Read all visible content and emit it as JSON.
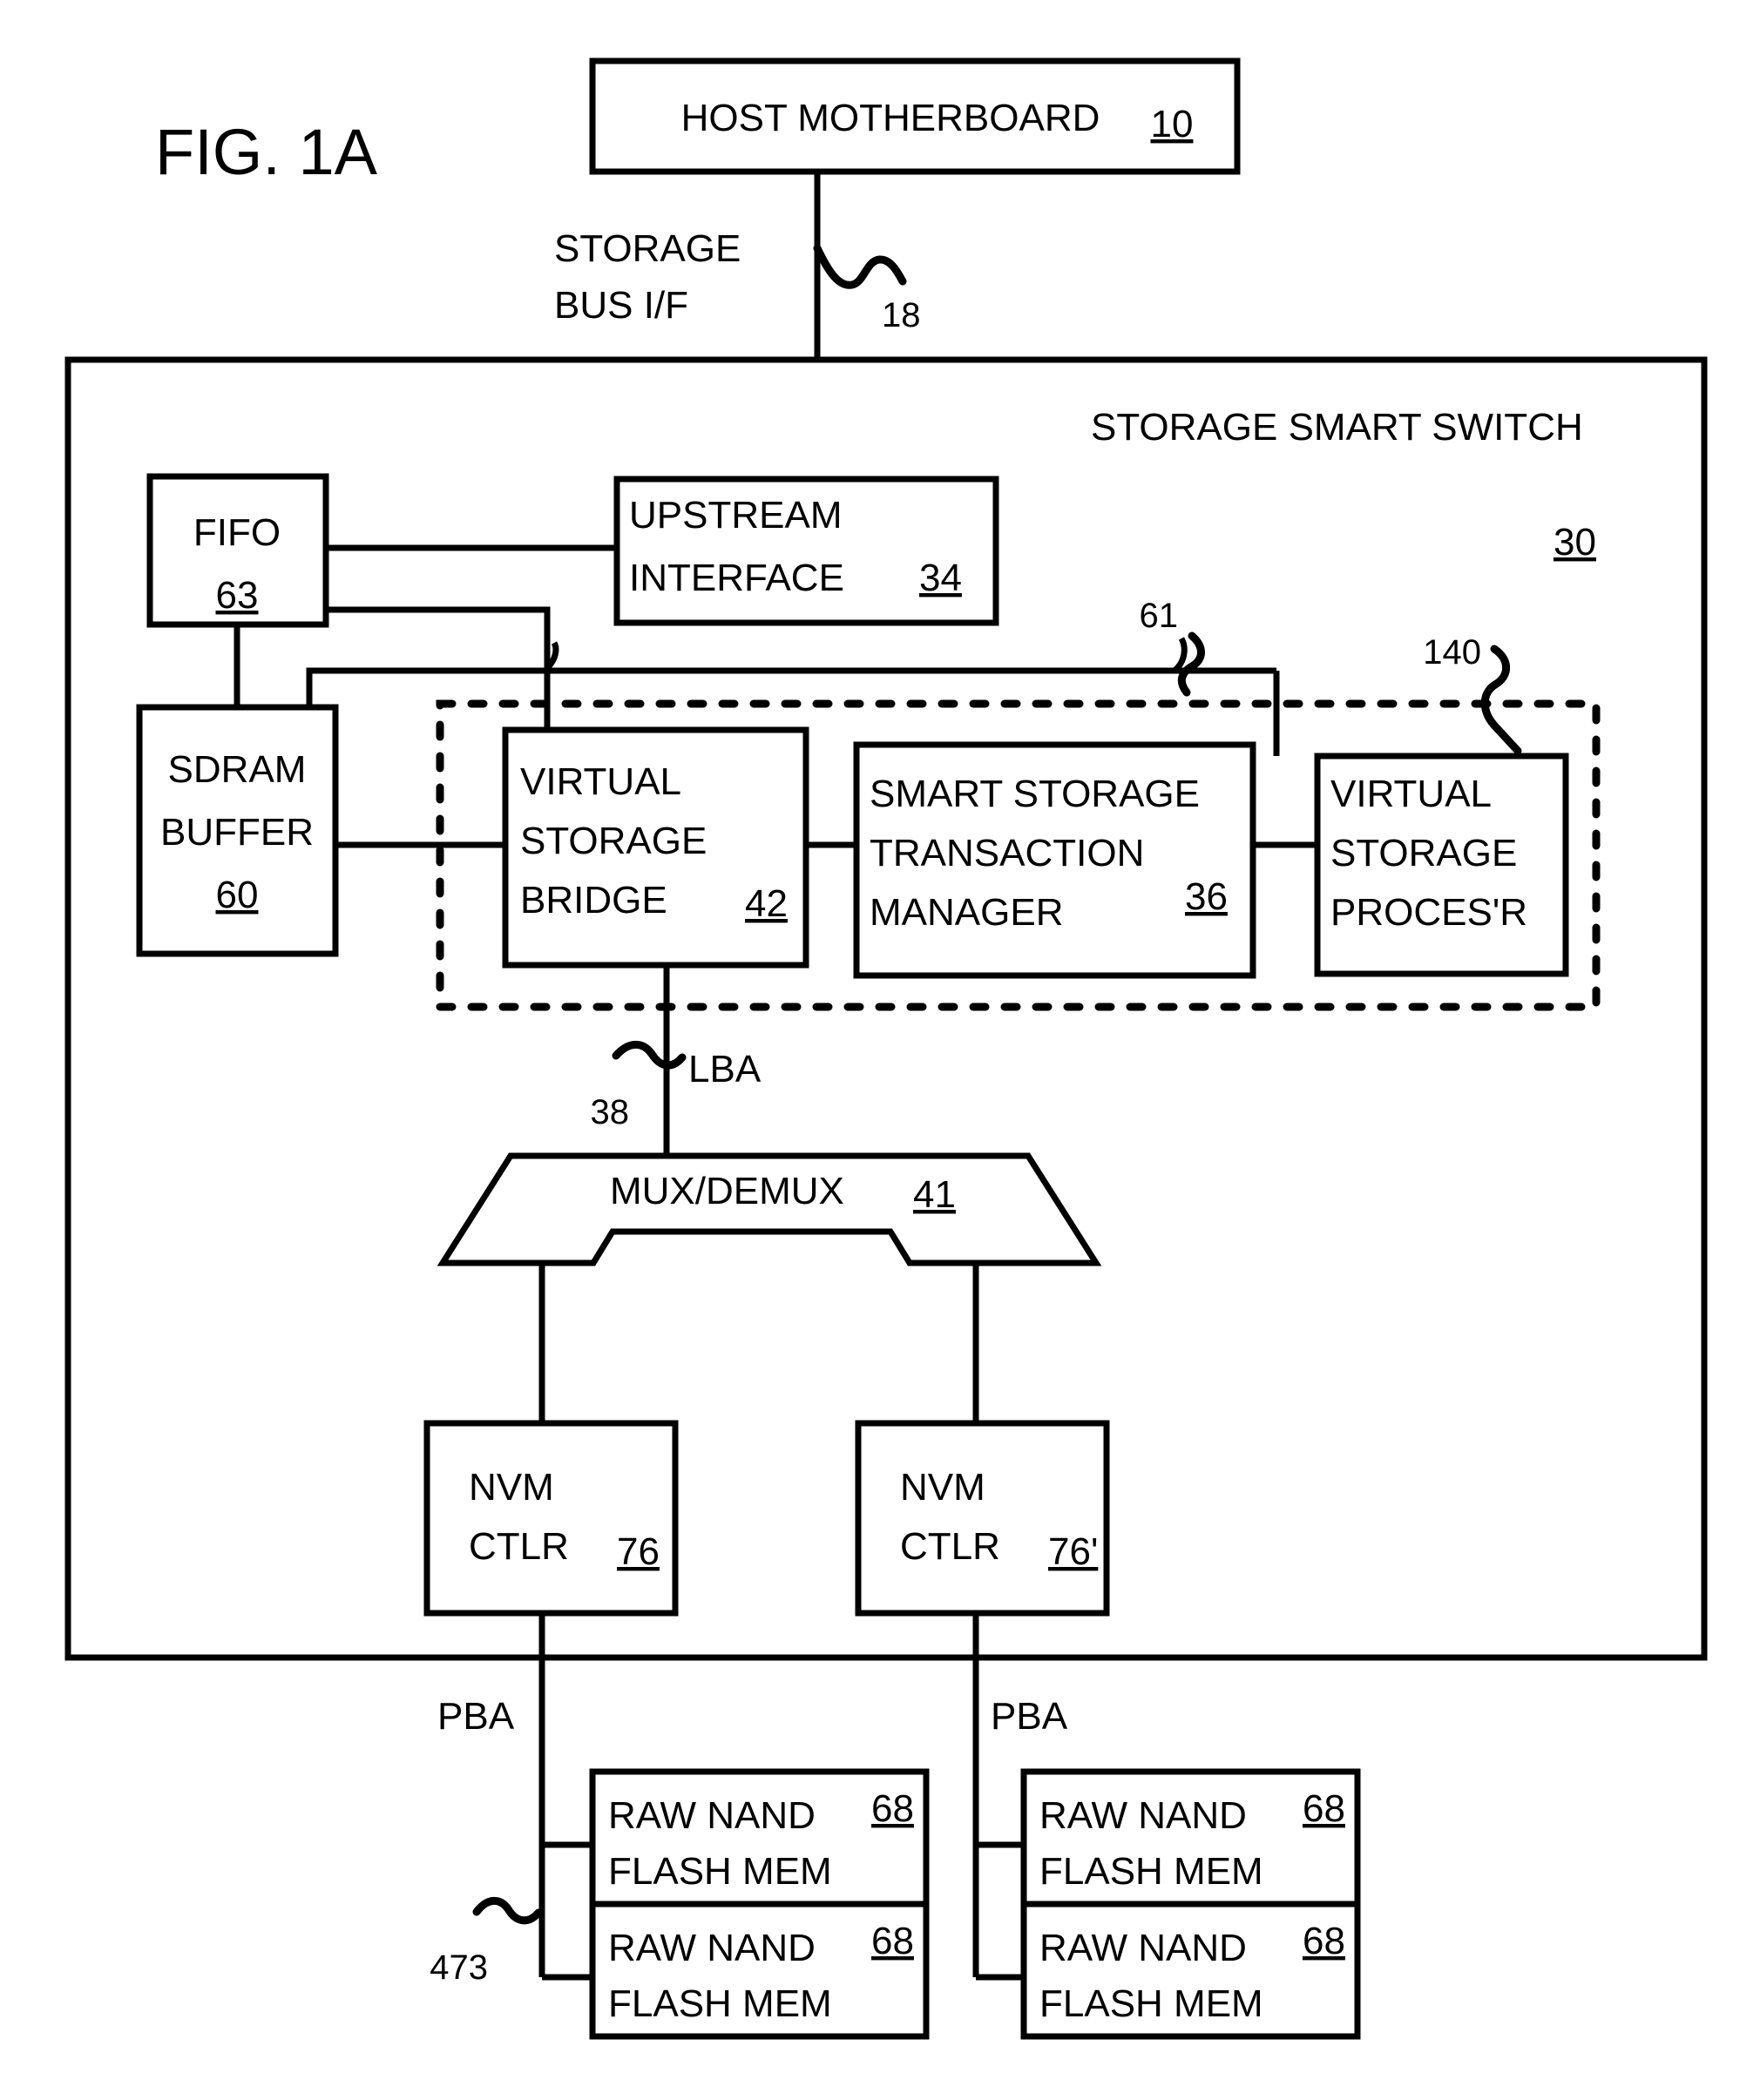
{
  "figure": {
    "label": "FIG. 1A"
  },
  "blocks": {
    "host_motherboard": {
      "title": "HOST MOTHERBOARD",
      "ref": "10"
    },
    "upstream_interface": {
      "line1": "UPSTREAM",
      "line2": "INTERFACE",
      "ref": "34"
    },
    "fifo": {
      "title": "FIFO",
      "ref": "63"
    },
    "sdram_buffer": {
      "line1": "SDRAM",
      "line2": "BUFFER",
      "ref": "60"
    },
    "virtual_storage_bridge": {
      "line1": "VIRTUAL",
      "line2": "STORAGE",
      "line3": "BRIDGE",
      "ref": "42"
    },
    "smart_storage_transaction_manager": {
      "line1": "SMART STORAGE",
      "line2": "TRANSACTION",
      "line3": "MANAGER",
      "ref": "36"
    },
    "virtual_storage_processor": {
      "line1": "VIRTUAL",
      "line2": "STORAGE",
      "line3": "PROCES'R"
    },
    "mux_demux": {
      "title": "MUX/DEMUX",
      "ref": "41"
    },
    "nvm_ctlr_left": {
      "line1": "NVM",
      "line2": "CTLR",
      "ref": "76"
    },
    "nvm_ctlr_right": {
      "line1": "NVM",
      "line2": "CTLR",
      "ref": "76'"
    },
    "raw_nand_l1": {
      "line1": "RAW NAND",
      "line2": "FLASH MEM",
      "ref": "68"
    },
    "raw_nand_l2": {
      "line1": "RAW NAND",
      "line2": "FLASH MEM",
      "ref": "68"
    },
    "raw_nand_r1": {
      "line1": "RAW NAND",
      "line2": "FLASH MEM",
      "ref": "68"
    },
    "raw_nand_r2": {
      "line1": "RAW NAND",
      "line2": "FLASH MEM",
      "ref": "68"
    }
  },
  "labels": {
    "storage_bus_if_line1": "STORAGE",
    "storage_bus_if_line2": "BUS I/F",
    "storage_bus_ref": "18",
    "storage_smart_switch": "STORAGE SMART SWITCH",
    "storage_smart_switch_ref": "30",
    "bus_61": "61",
    "bus_140": "140",
    "lba": "LBA",
    "lba_ref": "38",
    "pba_left": "PBA",
    "pba_right": "PBA",
    "nand_bus_ref": "473"
  },
  "colors": {
    "stroke": "#000000",
    "background": "#ffffff"
  }
}
